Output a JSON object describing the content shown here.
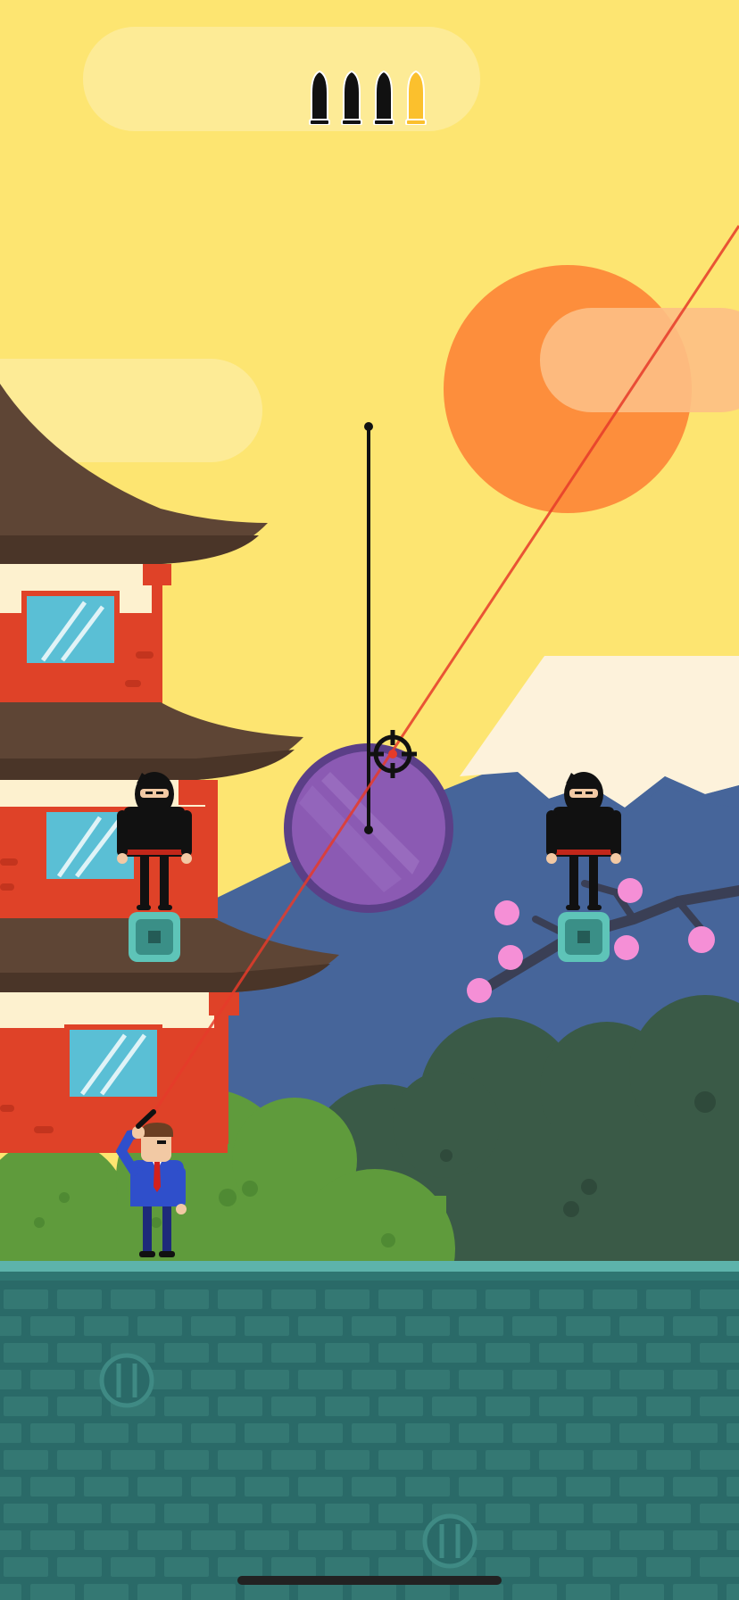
{
  "game": {
    "ammo": {
      "total": 4,
      "spent": 3,
      "remaining": 1
    },
    "colors": {
      "sky": "#fde571",
      "sun": "#fd8e3c",
      "cloud": "#fdeb96",
      "mountain": "#46659a",
      "snow": "#fdf2db",
      "temple_roof": "#5e4535",
      "temple_wall": "#df4228",
      "temple_plaster": "#fdf1cf",
      "window": "#5abfd5",
      "bush_light": "#5f9b3c",
      "bush_dark": "#3a5a47",
      "ground": "#2a6a68",
      "brick": "#347873",
      "ground_edge": "#5db3ab",
      "gong": "#8b5ab3",
      "laser": "#e63b2a",
      "bullet_spent": "#111111",
      "bullet_loaded": "#fbc02d",
      "pedestal": "#5ec4b8"
    },
    "icons": {
      "crosshair": "crosshair-icon",
      "bullet": "bullet-icon",
      "vent": "vent-grate-icon"
    },
    "characters": [
      "agent-player",
      "ninja-enemy",
      "ninja-enemy"
    ]
  }
}
